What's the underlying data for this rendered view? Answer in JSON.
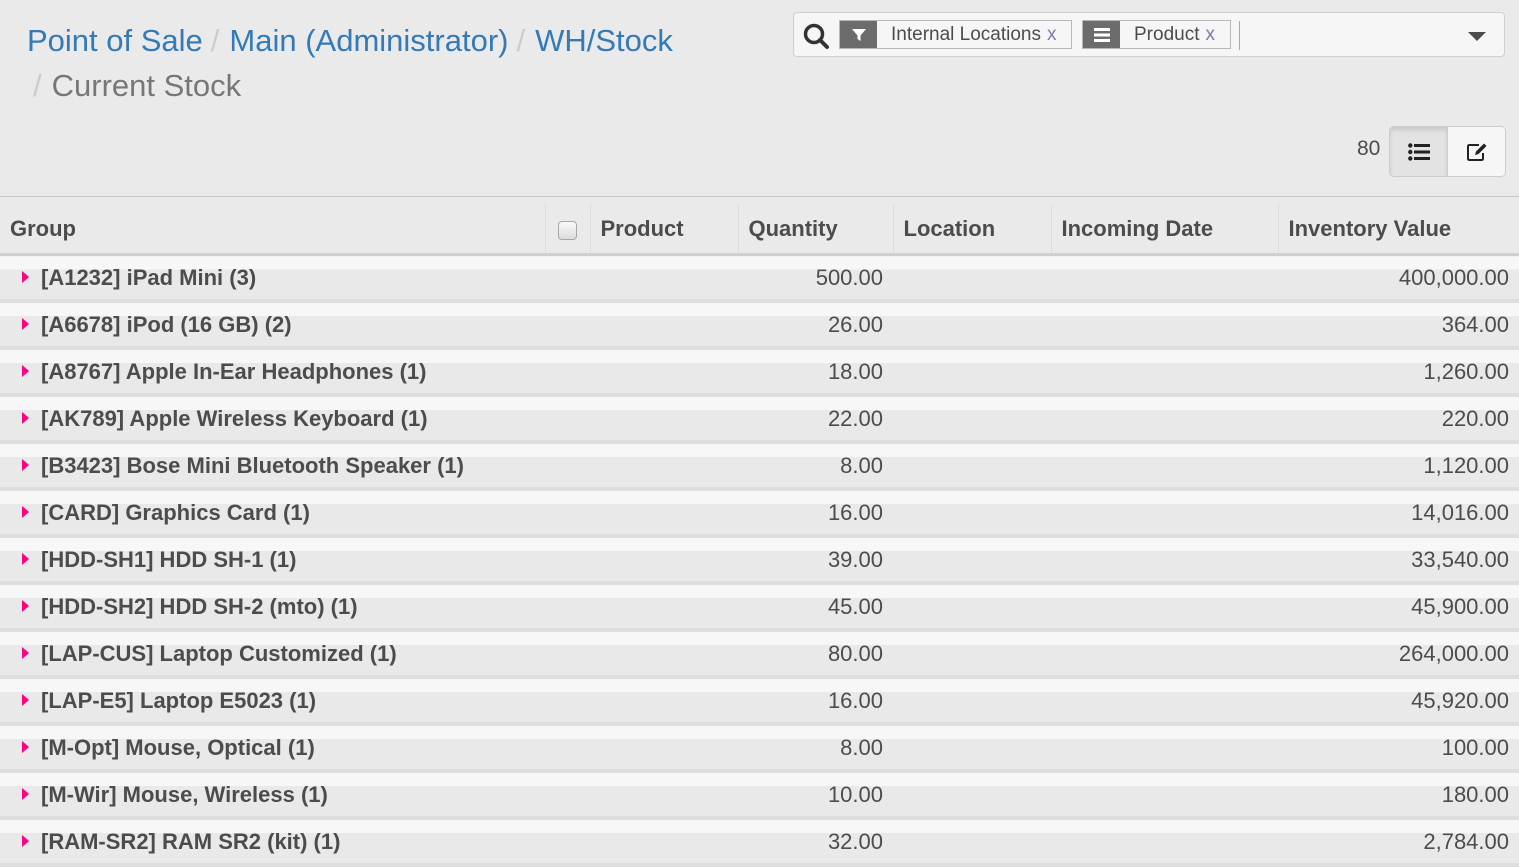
{
  "breadcrumb": {
    "items": [
      "Point of Sale",
      "Main (Administrator)",
      "WH/Stock"
    ],
    "current": "Current Stock",
    "separator": "/"
  },
  "search": {
    "facets": [
      {
        "type": "filter",
        "icon": "filter-icon",
        "label": "Internal Locations",
        "remove": "x"
      },
      {
        "type": "groupby",
        "icon": "list-icon",
        "label": "Product",
        "remove": "x"
      }
    ],
    "input_value": "",
    "placeholder": ""
  },
  "pager": {
    "count": "80"
  },
  "view_switcher": {
    "list_icon": "list-view-icon",
    "edit_icon": "edit-view-icon"
  },
  "table": {
    "columns": [
      "Group",
      "Product",
      "Quantity",
      "Location",
      "Incoming Date",
      "Inventory Value"
    ],
    "rows": [
      {
        "group": "[A1232] iPad Mini (3)",
        "quantity": "500.00",
        "value": "400,000.00"
      },
      {
        "group": "[A6678] iPod (16 GB) (2)",
        "quantity": "26.00",
        "value": "364.00"
      },
      {
        "group": "[A8767] Apple In-Ear Headphones (1)",
        "quantity": "18.00",
        "value": "1,260.00"
      },
      {
        "group": "[AK789] Apple Wireless Keyboard (1)",
        "quantity": "22.00",
        "value": "220.00"
      },
      {
        "group": "[B3423] Bose Mini Bluetooth Speaker (1)",
        "quantity": "8.00",
        "value": "1,120.00"
      },
      {
        "group": "[CARD] Graphics Card (1)",
        "quantity": "16.00",
        "value": "14,016.00"
      },
      {
        "group": "[HDD-SH1] HDD SH-1 (1)",
        "quantity": "39.00",
        "value": "33,540.00"
      },
      {
        "group": "[HDD-SH2] HDD SH-2 (mto) (1)",
        "quantity": "45.00",
        "value": "45,900.00"
      },
      {
        "group": "[LAP-CUS] Laptop Customized (1)",
        "quantity": "80.00",
        "value": "264,000.00"
      },
      {
        "group": "[LAP-E5] Laptop E5023 (1)",
        "quantity": "16.00",
        "value": "45,920.00"
      },
      {
        "group": "[M-Opt] Mouse, Optical (1)",
        "quantity": "8.00",
        "value": "100.00"
      },
      {
        "group": "[M-Wir] Mouse, Wireless (1)",
        "quantity": "10.00",
        "value": "180.00"
      },
      {
        "group": "[RAM-SR2] RAM SR2 (kit) (1)",
        "quantity": "32.00",
        "value": "2,784.00"
      }
    ]
  },
  "colors": {
    "link": "#337ab7",
    "caret": "#ff0080",
    "facet_icon_bg": "#6c6c6c",
    "facet_remove": "#7c7bad"
  }
}
